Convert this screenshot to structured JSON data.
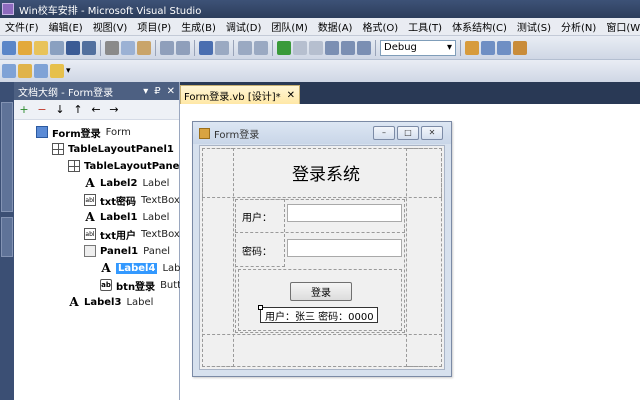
{
  "window": {
    "title": "Win校车安排 - Microsoft Visual Studio"
  },
  "menu": [
    "文件(F)",
    "编辑(E)",
    "视图(V)",
    "项目(P)",
    "生成(B)",
    "调试(D)",
    "团队(M)",
    "数据(A)",
    "格式(O)",
    "工具(T)",
    "体系结构(C)",
    "测试(S)",
    "分析(N)",
    "窗口(W)"
  ],
  "toolbar": {
    "config": "Debug"
  },
  "outline": {
    "title": "文档大纲 - Form登录",
    "controls": [
      "▾",
      "₽",
      "✕"
    ],
    "tools": [
      "+",
      "−",
      "↓",
      "↑",
      "←",
      "→"
    ],
    "nodes": [
      {
        "indent": 0,
        "icon": "form-icon",
        "name": "Form登录",
        "type": "Form"
      },
      {
        "indent": 1,
        "icon": "tablelayout-icon",
        "name": "TableLayoutPanel1",
        "type": ""
      },
      {
        "indent": 2,
        "icon": "tablelayout-icon",
        "name": "TableLayoutPanel2",
        "type": ""
      },
      {
        "indent": 3,
        "icon": "label-icon",
        "name": "Label2",
        "type": "Label"
      },
      {
        "indent": 3,
        "icon": "textbox-icon",
        "name": "txt密码",
        "type": "TextBox"
      },
      {
        "indent": 3,
        "icon": "label-icon",
        "name": "Label1",
        "type": "Label"
      },
      {
        "indent": 3,
        "icon": "textbox-icon",
        "name": "txt用户",
        "type": "TextBox"
      },
      {
        "indent": 3,
        "icon": "panel-icon",
        "name": "Panel1",
        "type": "Panel"
      },
      {
        "indent": 4,
        "icon": "label-icon",
        "name": "Label4",
        "type": "Label",
        "selected": true
      },
      {
        "indent": 4,
        "icon": "button-icon",
        "name": "btn登录",
        "type": "Button"
      },
      {
        "indent": 2,
        "icon": "label-icon",
        "name": "Label3",
        "type": "Label"
      }
    ]
  },
  "doc": {
    "tab": "Form登录.vb [设计]*",
    "close": "✕"
  },
  "form": {
    "title": "Form登录",
    "heading": "登录系统",
    "user_label": "用户：",
    "pass_label": "密码：",
    "button": "登录",
    "hint": "用户：张三   密码：0000"
  }
}
